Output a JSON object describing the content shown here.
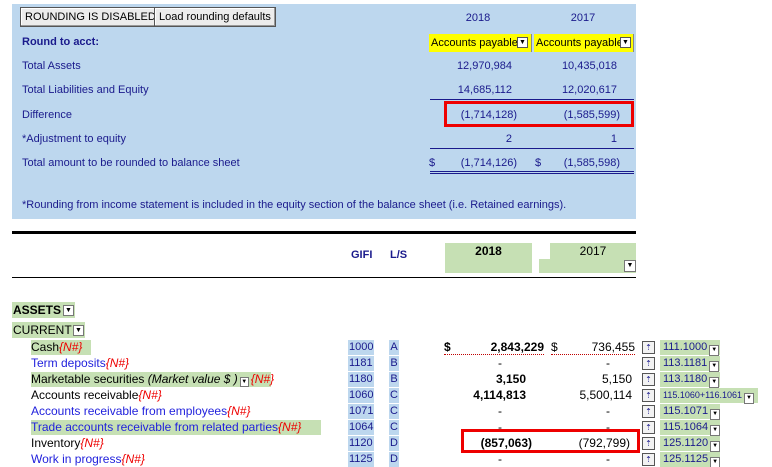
{
  "panel": {
    "buttons": {
      "rounding_disabled": "ROUNDING IS DISABLED",
      "load_defaults": "Load rounding defaults"
    },
    "years": [
      "2018",
      "2017"
    ],
    "round_to_acct_label": "Round to acct:",
    "round_to_acct": [
      "Accounts payable",
      "Accounts payable"
    ],
    "rows": [
      {
        "label": "Total Assets",
        "v2018": "12,970,984",
        "v2017": "10,435,018"
      },
      {
        "label": "Total Liabilities and Equity",
        "v2018": "14,685,112",
        "v2017": "12,020,617"
      },
      {
        "label": "Difference",
        "v2018": "(1,714,128)",
        "v2017": "(1,585,599)"
      },
      {
        "label": "*Adjustment to equity",
        "v2018": "2",
        "v2017": "1"
      },
      {
        "label": "Total amount to be rounded to balance sheet",
        "currency": "$",
        "v2018": "(1,714,126)",
        "v2017": "(1,585,598)"
      }
    ],
    "footnote": "*Rounding from income statement is included in the equity section of the balance sheet (i.e. Retained earnings)."
  },
  "grid": {
    "headers": {
      "gifi": "GIFI",
      "ls": "L/S",
      "y2018": "2018",
      "y2017": "2017"
    },
    "sections": {
      "assets": "ASSETS",
      "current": "CURRENT"
    },
    "asterisk": "{N#}",
    "rows": [
      {
        "label": "Cash",
        "note": "",
        "gifi": "1000",
        "ls": "A",
        "v2018": "2,843,229",
        "v2017": "736,455",
        "cur18": "$",
        "cur17": "$",
        "acct": "111.1000"
      },
      {
        "label": "Term deposits",
        "note": "",
        "gifi": "1181",
        "ls": "B",
        "v2018": "-",
        "v2017": "-",
        "acct": "113.1181"
      },
      {
        "label": "Marketable securities ",
        "note": "(Market value $  )",
        "gifi": "1180",
        "ls": "B",
        "v2018": "3,150",
        "v2017": "5,150",
        "acct": "113.1180"
      },
      {
        "label": "Accounts receivable",
        "note": "",
        "gifi": "1060",
        "ls": "C",
        "v2018": "4,114,813",
        "v2017": "5,500,114",
        "acct": "115.1060+116.1061"
      },
      {
        "label": "Accounts receivable from employees",
        "note": "",
        "gifi": "1071",
        "ls": "C",
        "v2018": "-",
        "v2017": "-",
        "acct": "115.1071"
      },
      {
        "label": "Trade accounts receivable from related parties",
        "note": "",
        "gifi": "1064",
        "ls": "C",
        "v2018": "-",
        "v2017": "-",
        "acct": "115.1064"
      },
      {
        "label": "Inventory",
        "note": "",
        "gifi": "1120",
        "ls": "D",
        "v2018": "(857,063)",
        "v2017": "(792,799)",
        "acct": "125.1120"
      },
      {
        "label": "Work in progress",
        "note": "",
        "gifi": "1125",
        "ls": "D",
        "v2018": "-",
        "v2017": "-",
        "acct": "125.1125"
      }
    ]
  },
  "colors": {
    "panel_bg": "#bdd7ee",
    "green_cell": "#c6e0b4",
    "highlight": "#ffff00",
    "red_box": "#ee0000",
    "label_blue": "#1a1a8c"
  },
  "icons": {
    "dropdown": "chevron-down-icon",
    "formula": "formula-icon"
  }
}
